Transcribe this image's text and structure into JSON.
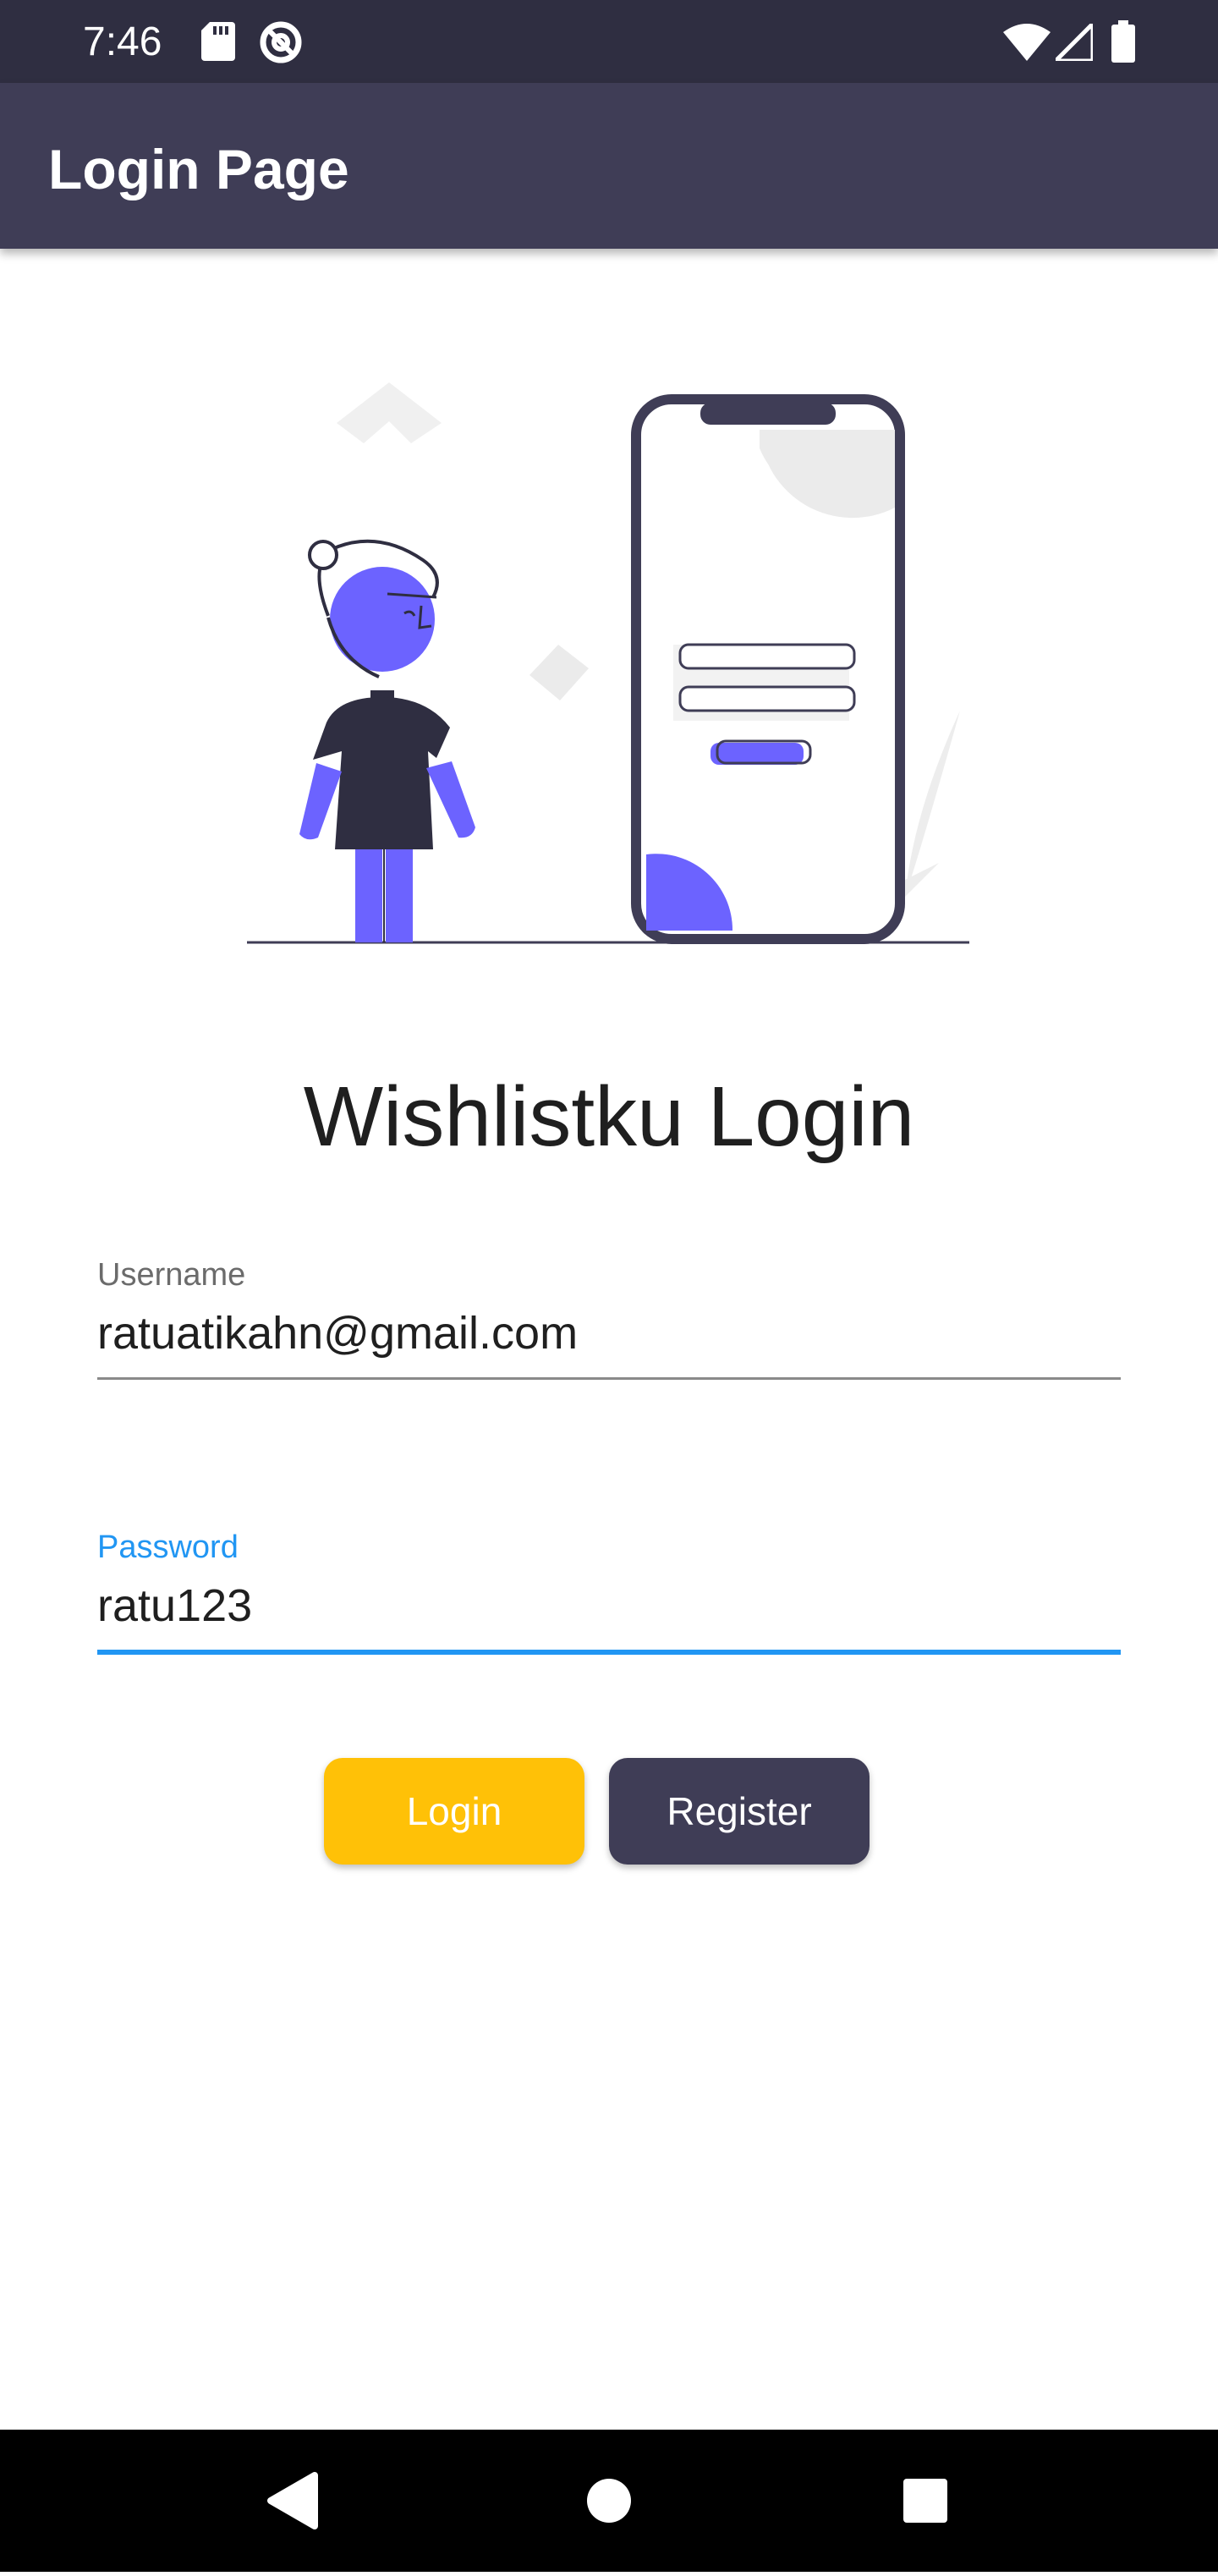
{
  "status_bar": {
    "time": "7:46",
    "icons": [
      "sd-card-icon",
      "no-disturb-icon",
      "wifi-icon",
      "cell-signal-icon",
      "battery-icon"
    ]
  },
  "app_bar": {
    "title": "Login Page"
  },
  "illustration": {
    "name": "person-with-phone-login-illustration",
    "accent_color": "#6c63ff",
    "dark_color": "#2f2e41"
  },
  "main": {
    "title": "Wishlistku Login"
  },
  "form": {
    "username": {
      "label": "Username",
      "value": "ratuatikahn@gmail.com"
    },
    "password": {
      "label": "Password",
      "value": "ratu123",
      "focused": true
    }
  },
  "buttons": {
    "login": "Login",
    "register": "Register"
  },
  "colors": {
    "status_bar": "#2f2e41",
    "app_bar": "#3f3d56",
    "focus": "#2196f3",
    "login_button": "#ffc107",
    "register_button": "#3f3d56"
  },
  "nav_bar": {
    "icons": [
      "back-icon",
      "home-icon",
      "recents-icon"
    ]
  }
}
